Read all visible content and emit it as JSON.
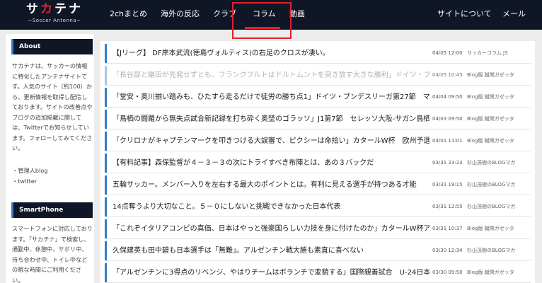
{
  "header": {
    "logo": {
      "main_a": "サ",
      "main_b": "カ",
      "main_c": "テナ",
      "sub": "~Soccer Antenna~"
    },
    "nav": [
      {
        "label": "2chまとめ"
      },
      {
        "label": "海外の反応"
      },
      {
        "label": "クラブ"
      },
      {
        "label": "コラム",
        "selected": true
      },
      {
        "label": "動画"
      },
      {
        "label": "サイトについて"
      },
      {
        "label": "メール"
      }
    ],
    "accent_color": "#e0212d",
    "bar_color": "#0f1626"
  },
  "sidebar": {
    "about_title": "About",
    "about_text": "サカテナは、サッカーの情報に特化したアンテナサイトです。人気のサイト（約100）から、更新情報を取得し配信しております。サイトの改善点やブログの追加掲載に関しては、Twitterでお知らせしています。フォローしてみてください。",
    "links": [
      "・管理人blog",
      "・twitter"
    ],
    "smartphone_title": "SmartPhone",
    "smartphone_text": "スマートフォンに対応しております。「サカテナ」で検索し、通勤中、休憩中、サボリ中、待ち合わせ中、トイレ中などの暇な時間にご利用ください。"
  },
  "articles": [
    {
      "title": "【Jリーグ】 DF岸本武流(徳島ヴォルティス)の右足のクロスが凄い。",
      "date": "04/05 12:00",
      "source": "サッカーコラム J3",
      "faded": false
    },
    {
      "title": "「長谷部と鎌田が先発せずとも、フランクフルトはドルトムントを突き放す大きな勝利」ドイツ・ブン",
      "date": "04/05 10:45",
      "source": "Blog版 蹴閑ガゼッタ",
      "faded": true
    },
    {
      "title": "「堂安・奥川揃い踏みも、ひたすら走るだけで徒労の勝ち点1」ドイツ・ブンデスリーガ第27節　マイ",
      "date": "04/04 09:50",
      "source": "Blog版 蹴閑ガゼッタ",
      "faded": false
    },
    {
      "title": "「鳥栖の闘羅から無失点試合新記録を打ち砕く奥埜のゴラッソ」J1第7節　セレッソ大阪-サガン鳥栖",
      "date": "04/03 09:50",
      "source": "Blog版 蹴閑ガゼッタ",
      "faded": false
    },
    {
      "title": "「クリロナがキャプテンマークを叩きつける大誤審で、ピクシーは命拾い」カタールW杯　欧州予選グ",
      "date": "04/01 11:01",
      "source": "Blog版 蹴閑ガゼッタ",
      "faded": false
    },
    {
      "title": "【有料記事】森保監督が４－３－３の次にトライすべき布陣とは、あの３バックだ",
      "date": "03/31 23:23",
      "source": "杉山茂樹のBLOGマガ",
      "faded": false
    },
    {
      "title": "五輪サッカー。メンバー入りを左右する最大のポイントとは。有利に見える選手が持つある才能",
      "date": "03/31 19:15",
      "source": "杉山茂樹のBLOGマガ",
      "faded": false
    },
    {
      "title": "14点奪うより大切なこと。５－０にしないと挑戦できなかった日本代表",
      "date": "03/31 12:55",
      "source": "杉山茂樹のBLOGマガ",
      "faded": false
    },
    {
      "title": "「これぞイタリアコンピの真価、日本はやっと強豪国らしい力技を身に付けたのか」カタールW杯アジ",
      "date": "03/31 10:37",
      "source": "Blog版 蹴閑ガゼッタ",
      "faded": false
    },
    {
      "title": "久保建英も田中碧も日本選手は「無難」。アルゼンチン戦大勝も素直に喜べない",
      "date": "03/30 12:34",
      "source": "杉山茂樹のBLOGマガ",
      "faded": false
    },
    {
      "title": "「アルゼンチンに3得点のリベンジ、やはりチームはボランチで変貌する」国際親善試合　U-24日本-",
      "date": "03/30 09:50",
      "source": "Blog版 蹴閑ガゼッタ",
      "faded": false
    }
  ]
}
